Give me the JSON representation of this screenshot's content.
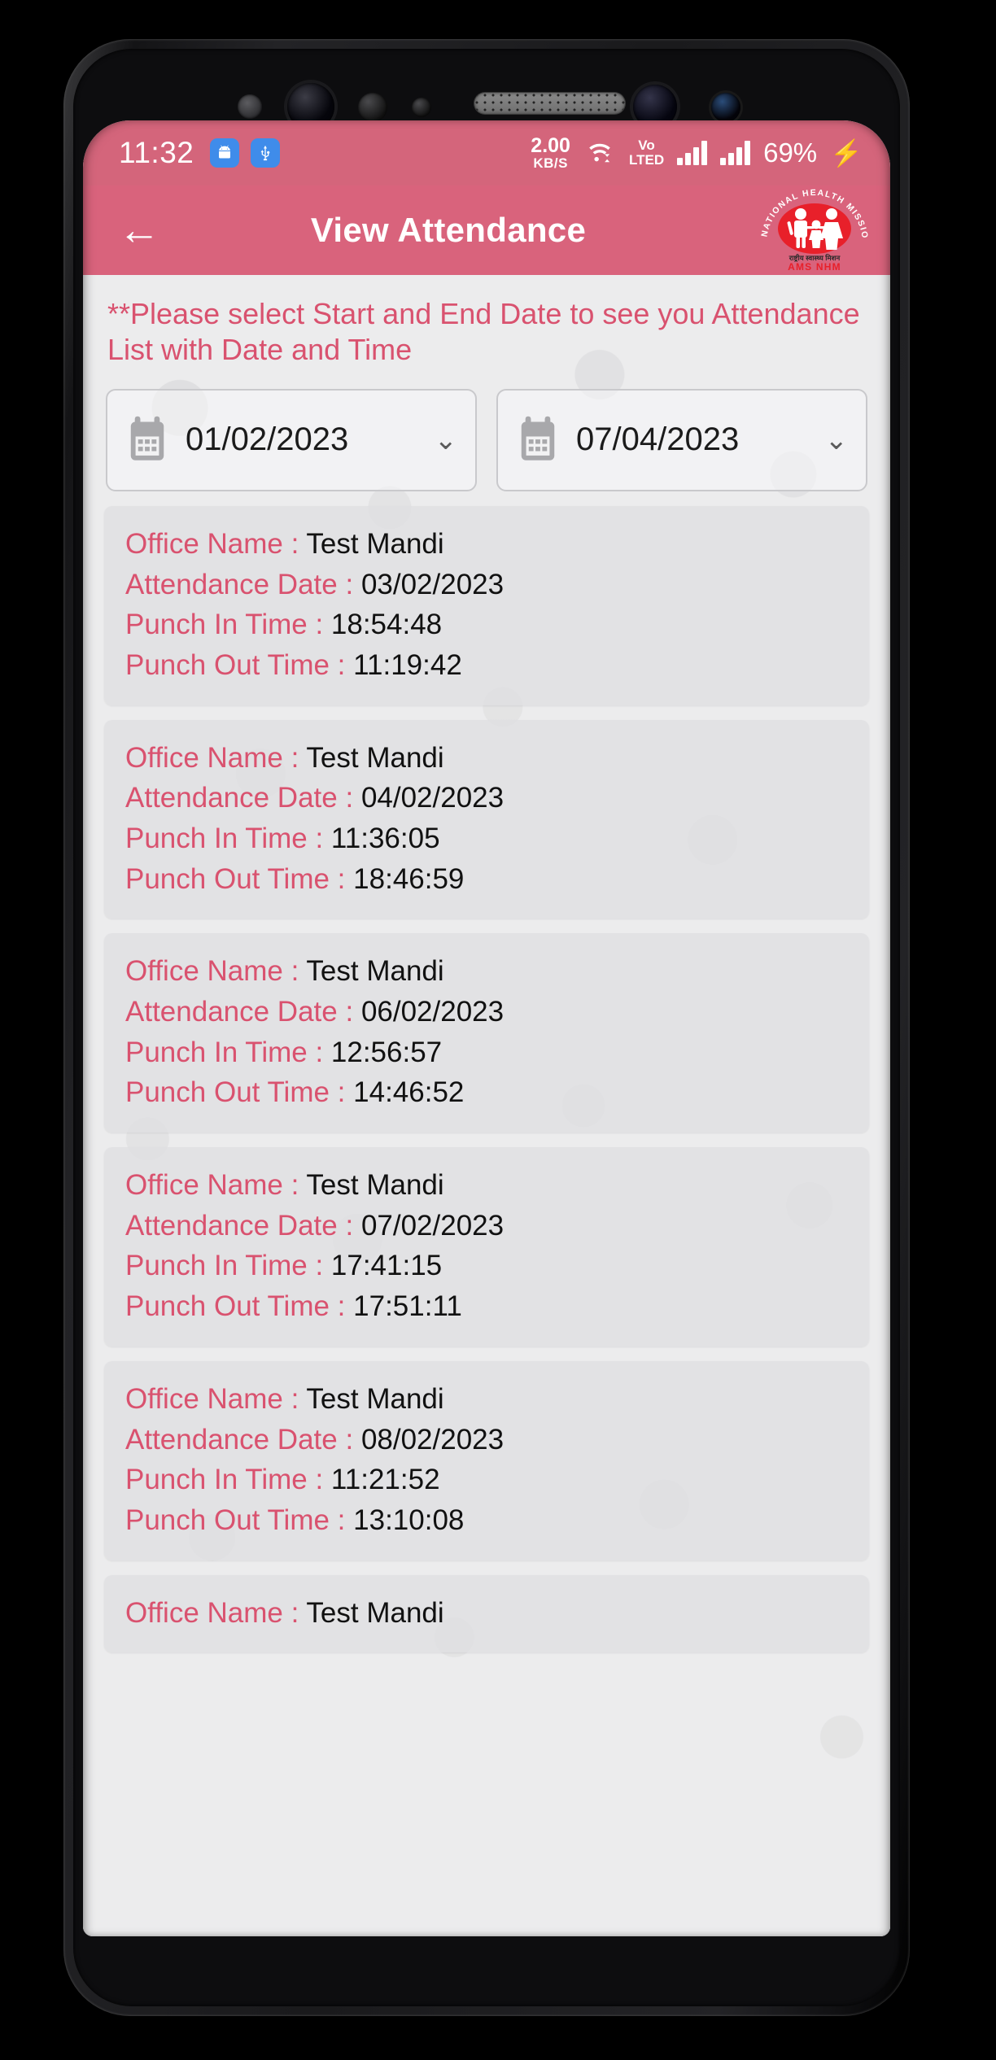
{
  "status_bar": {
    "time": "11:32",
    "left_icons": [
      "android-icon",
      "usb-icon"
    ],
    "net_speed_value": "2.00",
    "net_speed_unit": "KB/S",
    "wifi_icon": "wifi-icon",
    "volte_top": "Vo",
    "volte_bottom": "LTED",
    "signal_icon_1": "signal-bars-icon",
    "signal_icon_2": "signal-bars-icon",
    "battery": "69%",
    "charging_icon": "charging-bolt-icon",
    "bg_color": "#d4657b"
  },
  "app_bar": {
    "back_icon": "back-arrow-icon",
    "title": "View Attendance",
    "bg_color": "#d9637c",
    "logo": {
      "arc_text": "NATIONAL HEALTH MISSION",
      "hindi_text": "राष्ट्रीय स्वास्थ्य मिशन",
      "abbrev": "AMS NHM",
      "color": "#e8202a"
    }
  },
  "notice": {
    "text": "**Please select Start and End Date to see you Attendance List with Date and Time",
    "color": "#d9526f"
  },
  "filters": {
    "start_date": {
      "label": "start-date",
      "value": "01/02/2023",
      "icon": "calendar-icon",
      "chevron": "chevron-down-icon"
    },
    "end_date": {
      "label": "end-date",
      "value": "07/04/2023",
      "icon": "calendar-icon",
      "chevron": "chevron-down-icon"
    }
  },
  "labels": {
    "office_name": "Office Name :",
    "attendance_date": "Attendance Date :",
    "punch_in": "Punch In Time :",
    "punch_out": "Punch Out Time :"
  },
  "records": [
    {
      "office_name": "Test Mandi",
      "attendance_date": "03/02/2023",
      "punch_in": "18:54:48",
      "punch_out": "11:19:42"
    },
    {
      "office_name": "Test Mandi",
      "attendance_date": "04/02/2023",
      "punch_in": "11:36:05",
      "punch_out": "18:46:59"
    },
    {
      "office_name": "Test Mandi",
      "attendance_date": "06/02/2023",
      "punch_in": "12:56:57",
      "punch_out": "14:46:52"
    },
    {
      "office_name": "Test Mandi",
      "attendance_date": "07/02/2023",
      "punch_in": "17:41:15",
      "punch_out": "17:51:11"
    },
    {
      "office_name": "Test Mandi",
      "attendance_date": "08/02/2023",
      "punch_in": "11:21:52",
      "punch_out": "13:10:08"
    },
    {
      "office_name": "Test Mandi",
      "attendance_date": "",
      "punch_in": "",
      "punch_out": ""
    }
  ]
}
